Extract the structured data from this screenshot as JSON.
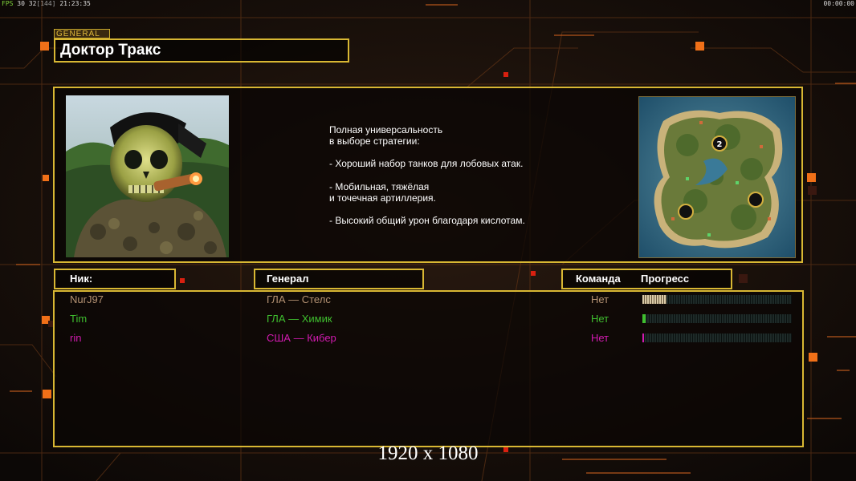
{
  "hud": {
    "fps_label": "FPS",
    "fps_a": "30",
    "fps_b": "32",
    "fps_c": "[144]",
    "clock": "21:23:35",
    "timer": "00:00:00"
  },
  "general_tag": "GENERAL",
  "general_name": "Доктор Тракс",
  "description": [
    "Полная универсальность\nв выборе стратегии:",
    "- Хороший набор танков для лобовых атак.",
    "- Мобильная, тяжёлая\nи точечная артиллерия.",
    "- Высокий общий урон благодаря кислотам."
  ],
  "map": {
    "player_marker": "2"
  },
  "headers": {
    "nick": "Ник:",
    "general": "Генерал",
    "team": "Команда",
    "progress": "Прогресс"
  },
  "players": [
    {
      "nick": "NurJ97",
      "general": "ГЛА — Стелс",
      "team": "Нет",
      "progress": 0.16,
      "color": "#b49273"
    },
    {
      "nick": "Tim",
      "general": "ГЛА — Химик",
      "team": "Нет",
      "progress": 0.02,
      "color": "#3fbf2f"
    },
    {
      "nick": "rin",
      "general": "США — Кибер",
      "team": "Нет",
      "progress": 0.01,
      "color": "#d21ab0"
    }
  ],
  "caption": "1920 x 1080",
  "colors": {
    "frame": "#d8b733",
    "accent": "#f07018"
  }
}
